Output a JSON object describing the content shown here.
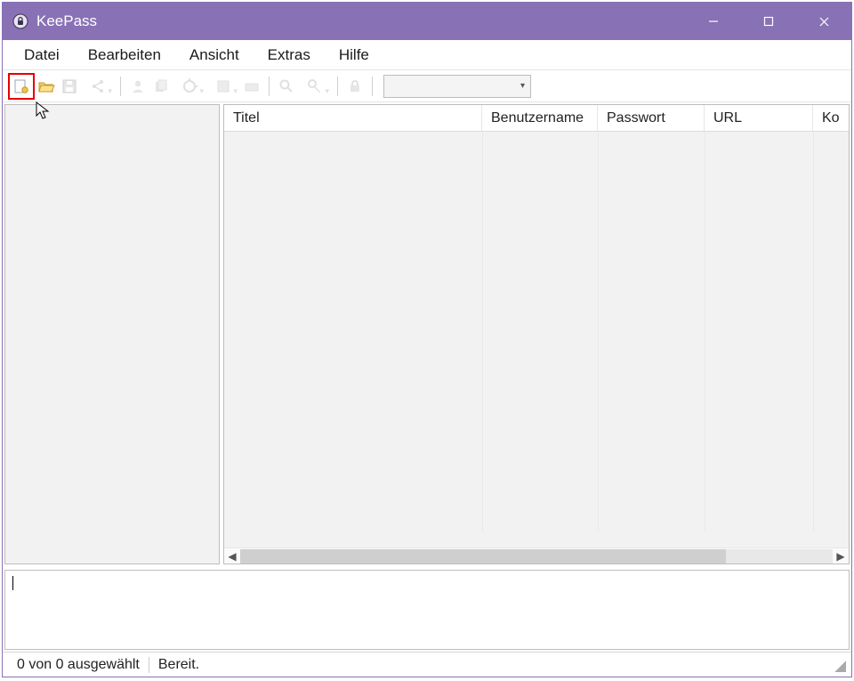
{
  "window": {
    "title": "KeePass"
  },
  "menu": {
    "items": [
      "Datei",
      "Bearbeiten",
      "Ansicht",
      "Extras",
      "Hilfe"
    ]
  },
  "toolbar": {
    "icons": {
      "new": "new-database-icon",
      "open": "open-database-icon",
      "save": "save-icon",
      "addentry": "add-entry-icon",
      "copyuser": "copy-user-icon",
      "copypw": "copy-password-icon",
      "url": "open-url-icon",
      "autotype": "autotype-icon",
      "find": "find-icon",
      "showentries": "show-entries-icon",
      "lock": "lock-workspace-icon"
    },
    "quicksearch_value": ""
  },
  "columns": {
    "title": "Titel",
    "user": "Benutzername",
    "password": "Passwort",
    "url": "URL",
    "comment": "Ko"
  },
  "status": {
    "selection": "0 von 0 ausgewählt",
    "state": "Bereit."
  }
}
